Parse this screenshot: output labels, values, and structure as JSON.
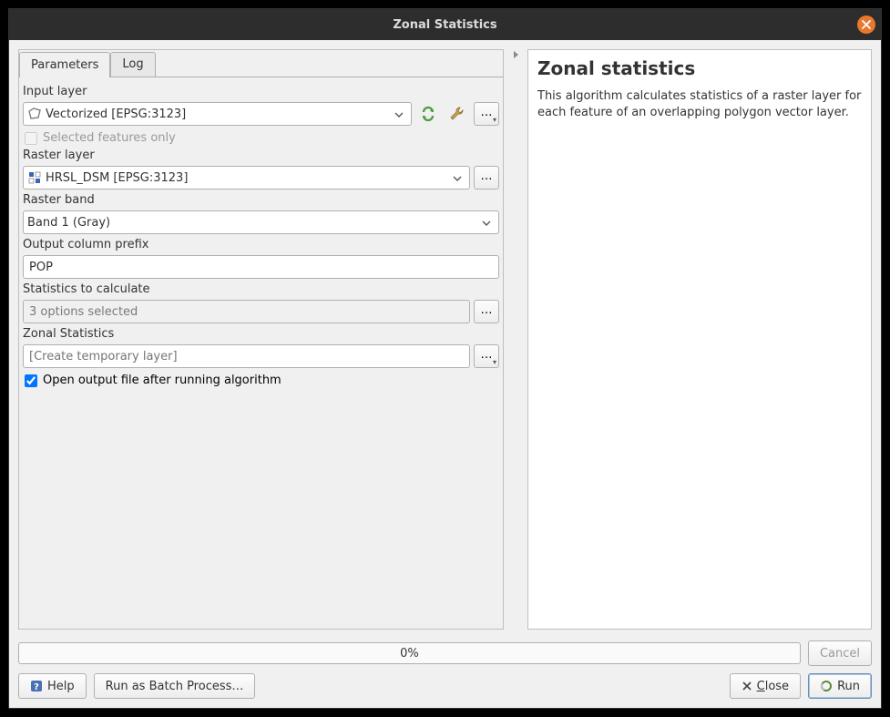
{
  "titlebar": {
    "title": "Zonal Statistics"
  },
  "tabs": {
    "parameters": "Parameters",
    "log": "Log"
  },
  "form": {
    "input_layer_label": "Input layer",
    "input_layer_value": "Vectorized [EPSG:3123]",
    "selected_features_label": "Selected features only",
    "raster_layer_label": "Raster layer",
    "raster_layer_value": "HRSL_DSM [EPSG:3123]",
    "raster_band_label": "Raster band",
    "raster_band_value": "Band 1 (Gray)",
    "output_prefix_label": "Output column prefix",
    "output_prefix_value": "POP",
    "stats_label": "Statistics to calculate",
    "stats_value": "3 options selected",
    "zonal_out_label": "Zonal Statistics",
    "zonal_out_placeholder": "[Create temporary layer]",
    "open_output_label": "Open output file after running algorithm"
  },
  "help": {
    "title": "Zonal statistics",
    "desc": "This algorithm calculates statistics of a raster layer for each feature of an overlapping polygon vector layer."
  },
  "progress": {
    "text": "0%"
  },
  "buttons": {
    "help": "Help",
    "batch": "Run as Batch Process…",
    "cancel": "Cancel",
    "close": "Close",
    "run": "Run"
  }
}
